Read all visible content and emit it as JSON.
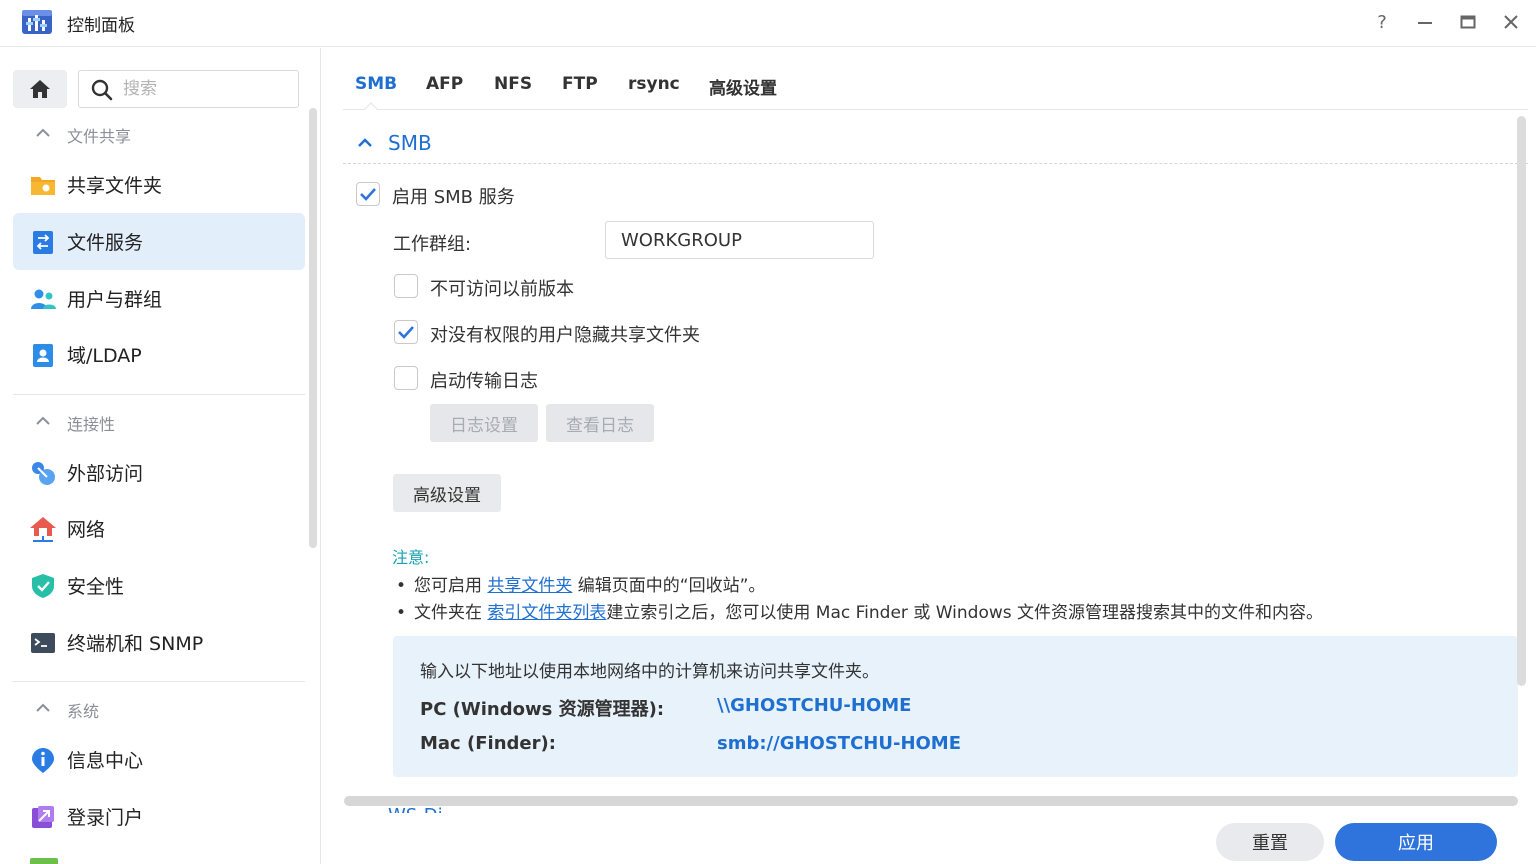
{
  "window": {
    "title": "控制面板",
    "controls": {
      "help": "?",
      "minimize": "—",
      "maximize": "▭",
      "close": "✕"
    }
  },
  "sidebar": {
    "search_placeholder": "搜索",
    "groups": [
      {
        "label": "文件共享"
      },
      {
        "label": "连接性"
      },
      {
        "label": "系统"
      }
    ],
    "items": [
      {
        "label": "共享文件夹",
        "icon": "folder-share-icon"
      },
      {
        "label": "文件服务",
        "icon": "file-services-icon",
        "active": true
      },
      {
        "label": "用户与群组",
        "icon": "users-icon"
      },
      {
        "label": "域/LDAP",
        "icon": "domain-ldap-icon"
      },
      {
        "label": "外部访问",
        "icon": "external-access-icon"
      },
      {
        "label": "网络",
        "icon": "network-icon"
      },
      {
        "label": "安全性",
        "icon": "shield-icon"
      },
      {
        "label": "终端机和 SNMP",
        "icon": "terminal-icon"
      },
      {
        "label": "信息中心",
        "icon": "info-icon"
      },
      {
        "label": "登录门户",
        "icon": "login-portal-icon"
      }
    ]
  },
  "tabs": [
    {
      "label": "SMB",
      "active": true
    },
    {
      "label": "AFP"
    },
    {
      "label": "NFS"
    },
    {
      "label": "FTP"
    },
    {
      "label": "rsync"
    },
    {
      "label": "高级设置"
    }
  ],
  "smb": {
    "section_title": "SMB",
    "enable_label": "启用 SMB 服务",
    "enable_checked": true,
    "workgroup_label": "工作群组:",
    "workgroup_value": "WORKGROUP",
    "options": [
      {
        "label": "不可访问以前版本",
        "checked": false
      },
      {
        "label": "对没有权限的用户隐藏共享文件夹",
        "checked": true
      },
      {
        "label": "启动传输日志",
        "checked": false
      }
    ],
    "log_settings_button": "日志设置",
    "view_log_button": "查看日志",
    "advanced_button": "高级设置",
    "note": {
      "title": "注意:",
      "line1_pre": "您可启用 ",
      "line1_link": "共享文件夹",
      "line1_post": " 编辑页面中的“回收站”。",
      "line2_pre": "文件夹在 ",
      "line2_link": "索引文件夹列表",
      "line2_post": "建立索引之后，您可以使用 Mac Finder 或 Windows 文件资源管理器搜索其中的文件和内容。"
    },
    "access": {
      "intro": "输入以下地址以使用本地网络中的计算机来访问共享文件夹。",
      "pc_label": "PC (Windows 资源管理器):",
      "pc_value": "\\\\GHOSTCHU-HOME",
      "mac_label": "Mac (Finder):",
      "mac_value": "smb://GHOSTCHU-HOME"
    },
    "next_section_cut": "WS-Di"
  },
  "footer": {
    "reset": "重置",
    "apply": "应用"
  },
  "colors": {
    "accent": "#1f6fd1",
    "apply_button": "#2f74dd",
    "active_item_bg": "#e3eefb",
    "info_box_bg": "#e8f2fb",
    "note_title": "#15a3b4"
  }
}
